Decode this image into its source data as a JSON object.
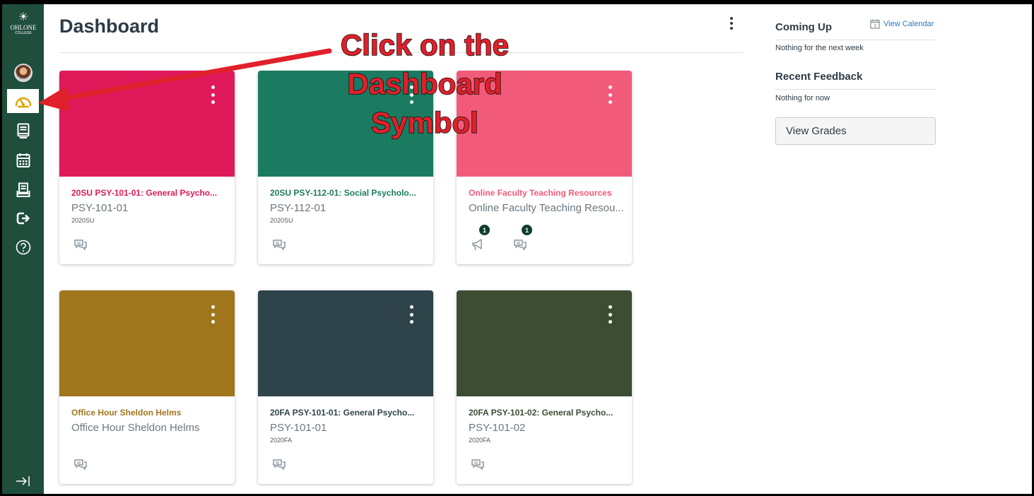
{
  "app": {
    "logo_text": "OHLONE",
    "logo_subtext": "COLLEGE"
  },
  "page": {
    "title": "Dashboard"
  },
  "sidebar": {
    "items": [
      {
        "name": "account",
        "icon": "avatar"
      },
      {
        "name": "dashboard",
        "icon": "dashboard-icon",
        "active": true
      },
      {
        "name": "courses",
        "icon": "courses-icon"
      },
      {
        "name": "calendar",
        "icon": "calendar-icon"
      },
      {
        "name": "inbox",
        "icon": "inbox-icon"
      },
      {
        "name": "logout",
        "icon": "logout-icon"
      },
      {
        "name": "help",
        "icon": "help-icon"
      }
    ],
    "collapse_icon": "collapse-icon"
  },
  "annotation": {
    "line1": "Click on the",
    "line2": "Dashboard",
    "line3": "Symbol",
    "color": "#e0202a"
  },
  "cards": [
    {
      "title": "20SU PSY-101-01: General Psycho...",
      "code": "PSY-101-01",
      "term": "2020SU",
      "color": "#e0195a",
      "badge": null
    },
    {
      "title": "20SU PSY-112-01: Social Psycholo...",
      "code": "PSY-112-01",
      "term": "2020SU",
      "color": "#1b7b61",
      "badge": null
    },
    {
      "title": "Online Faculty Teaching Resources",
      "code": "Online Faculty Teaching Resou...",
      "term": "",
      "color": "#f25a7a",
      "badges": [
        "1",
        "1"
      ]
    },
    {
      "title": "Office Hour Sheldon Helms",
      "code": "Office Hour Sheldon Helms",
      "term": "",
      "color": "#a0761d",
      "badge": null
    },
    {
      "title": "20FA PSY-101-01: General Psycho...",
      "code": "PSY-101-01",
      "term": "2020FA",
      "color": "#2f444a",
      "badge": null
    },
    {
      "title": "20FA PSY-101-02: General Psycho...",
      "code": "PSY-101-02",
      "term": "2020FA",
      "color": "#3d4d33",
      "badge": null
    }
  ],
  "right": {
    "coming_up": "Coming Up",
    "view_calendar": "View Calendar",
    "calendar_day": "3",
    "coming_up_empty": "Nothing for the next week",
    "recent_feedback": "Recent Feedback",
    "feedback_empty": "Nothing for now",
    "view_grades": "View Grades"
  }
}
